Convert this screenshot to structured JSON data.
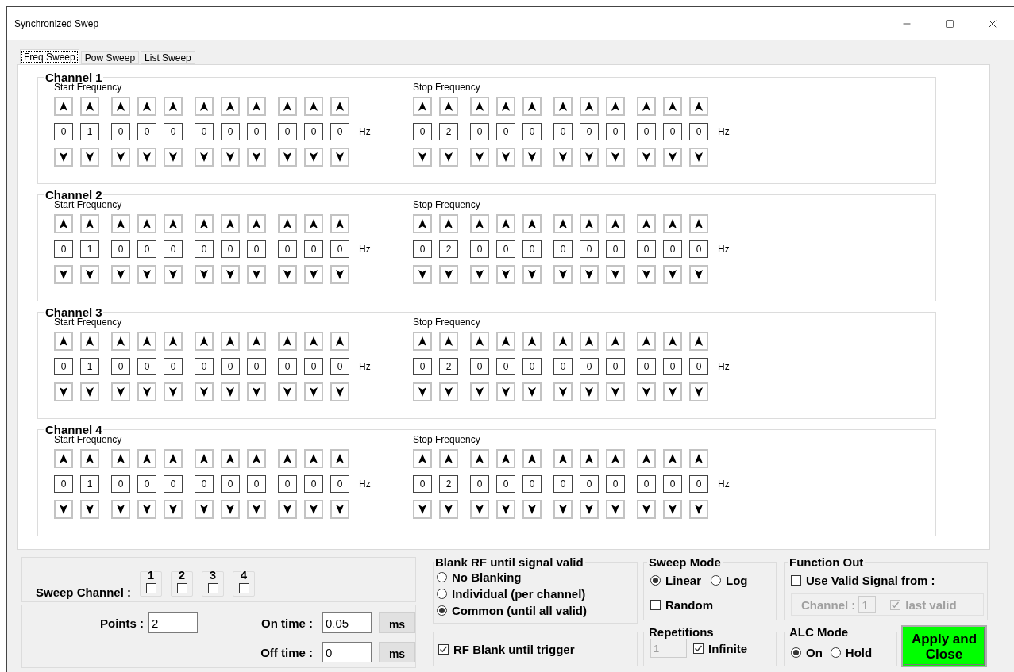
{
  "window": {
    "title": "Synchronized Swep"
  },
  "tabs": [
    {
      "label": "Freq Sweep",
      "selected": true
    },
    {
      "label": "Pow Sweep",
      "selected": false
    },
    {
      "label": "List Sweep",
      "selected": false
    }
  ],
  "channels": [
    {
      "title": "Channel 1",
      "start": {
        "label": "Start Frequency",
        "digits": [
          "0",
          "1",
          "0",
          "0",
          "0",
          "0",
          "0",
          "0",
          "0",
          "0",
          "0"
        ],
        "unit": "Hz"
      },
      "stop": {
        "label": "Stop Frequency",
        "digits": [
          "0",
          "2",
          "0",
          "0",
          "0",
          "0",
          "0",
          "0",
          "0",
          "0",
          "0"
        ],
        "unit": "Hz"
      }
    },
    {
      "title": "Channel 2",
      "start": {
        "label": "Start Frequency",
        "digits": [
          "0",
          "1",
          "0",
          "0",
          "0",
          "0",
          "0",
          "0",
          "0",
          "0",
          "0"
        ],
        "unit": "Hz"
      },
      "stop": {
        "label": "Stop Frequency",
        "digits": [
          "0",
          "2",
          "0",
          "0",
          "0",
          "0",
          "0",
          "0",
          "0",
          "0",
          "0"
        ],
        "unit": "Hz"
      }
    },
    {
      "title": "Channel 3",
      "start": {
        "label": "Start Frequency",
        "digits": [
          "0",
          "1",
          "0",
          "0",
          "0",
          "0",
          "0",
          "0",
          "0",
          "0",
          "0"
        ],
        "unit": "Hz"
      },
      "stop": {
        "label": "Stop Frequency",
        "digits": [
          "0",
          "2",
          "0",
          "0",
          "0",
          "0",
          "0",
          "0",
          "0",
          "0",
          "0"
        ],
        "unit": "Hz"
      }
    },
    {
      "title": "Channel 4",
      "start": {
        "label": "Start Frequency",
        "digits": [
          "0",
          "1",
          "0",
          "0",
          "0",
          "0",
          "0",
          "0",
          "0",
          "0",
          "0"
        ],
        "unit": "Hz"
      },
      "stop": {
        "label": "Stop Frequency",
        "digits": [
          "0",
          "2",
          "0",
          "0",
          "0",
          "0",
          "0",
          "0",
          "0",
          "0",
          "0"
        ],
        "unit": "Hz"
      }
    }
  ],
  "sweep_channel": {
    "label": "Sweep Channel :",
    "channels": [
      {
        "label": "1",
        "checked": false
      },
      {
        "label": "2",
        "checked": false
      },
      {
        "label": "3",
        "checked": false
      },
      {
        "label": "4",
        "checked": false
      }
    ]
  },
  "timing": {
    "points_label": "Points :",
    "points": "2",
    "on_label": "On time :",
    "on_value": "0.05",
    "on_unit": "ms",
    "off_label": "Off time :",
    "off_value": "0",
    "off_unit": "ms"
  },
  "blank_rf": {
    "title": "Blank RF until signal valid",
    "options": [
      {
        "label": "No Blanking",
        "selected": false
      },
      {
        "label": "Individual (per channel)",
        "selected": false
      },
      {
        "label": "Common (until all valid)",
        "selected": true
      }
    ]
  },
  "rf_blank_trigger": {
    "label": "RF Blank until trigger",
    "checked": true
  },
  "sweep_mode": {
    "title": "Sweep Mode",
    "options": [
      {
        "label": "Linear",
        "selected": true
      },
      {
        "label": "Log",
        "selected": false
      }
    ],
    "random": {
      "label": "Random",
      "checked": false
    }
  },
  "function_out": {
    "title": "Function Out",
    "use_valid": {
      "label": "Use Valid Signal from :",
      "checked": false
    },
    "channel_label": "Channel :",
    "channel_value": "1",
    "last_valid": {
      "label": "last valid",
      "checked": true
    },
    "disabled": true
  },
  "repetitions": {
    "title": "Repetitions",
    "value": "1",
    "infinite": {
      "label": "Infinite",
      "checked": true
    }
  },
  "alc_mode": {
    "title": "ALC Mode",
    "options": [
      {
        "label": "On",
        "selected": true
      },
      {
        "label": "Hold",
        "selected": false
      }
    ]
  },
  "apply_button": "Apply and Close"
}
